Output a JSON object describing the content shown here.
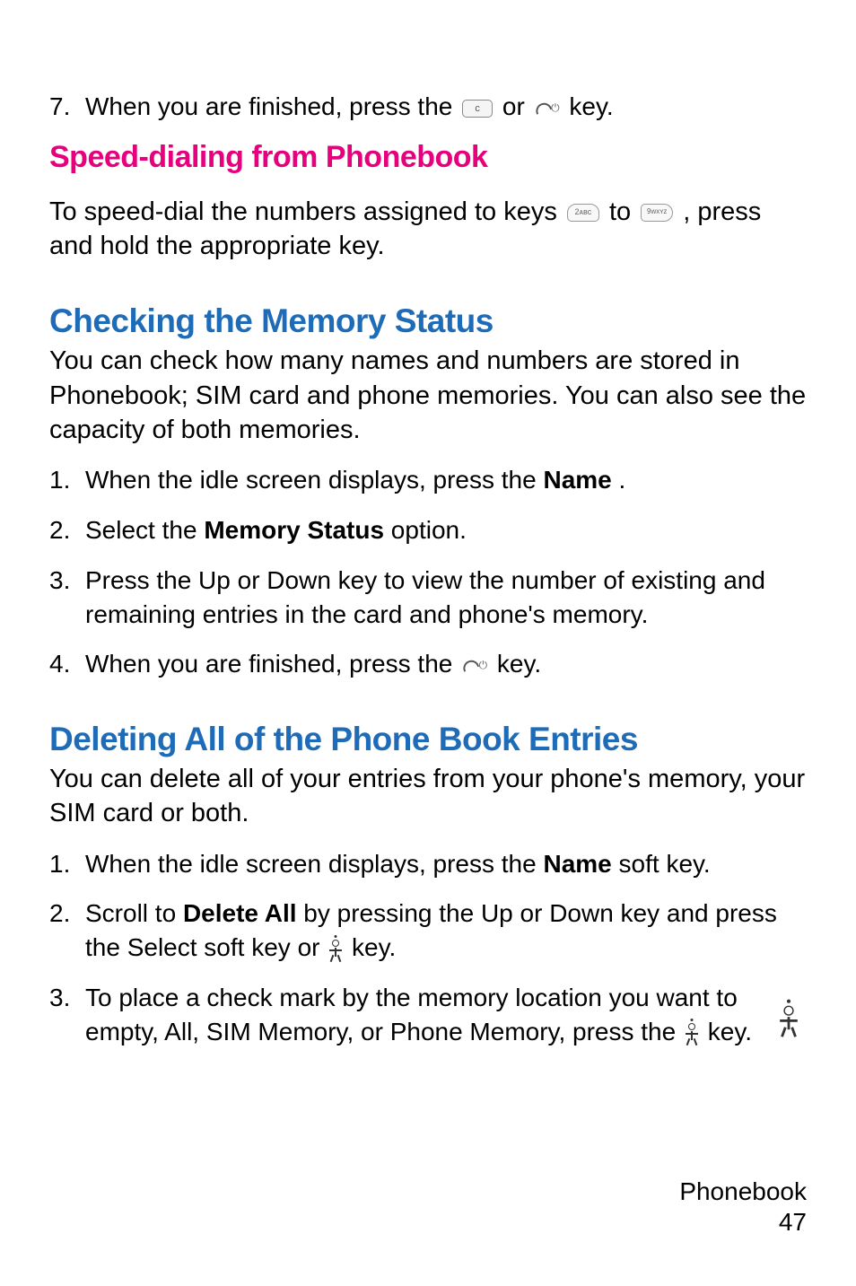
{
  "step7": {
    "num": "7.",
    "text_before": "When you are finished, press the ",
    "text_mid": " or ",
    "text_after": " key."
  },
  "speed_dial": {
    "heading": "Speed-dialing from Phonebook",
    "para_before": "To speed-dial the numbers assigned to keys ",
    "para_mid": " to ",
    "para_after": " , press and hold the appropriate key."
  },
  "memory_status": {
    "heading": "Checking the Memory Status",
    "intro": "You can check how many names and numbers are stored in Phonebook; SIM card and phone memories. You can also see the capacity of both memories.",
    "steps": [
      {
        "num": "1.",
        "pre": "When the idle screen displays, press the ",
        "bold": "Name",
        "post": "           ."
      },
      {
        "num": "2.",
        "pre": "Select the ",
        "bold": "Memory Status",
        "post": " option."
      },
      {
        "num": "3.",
        "pre": "Press the Up or Down key to view the number of existing and remaining entries in the card and phone's memory.",
        "bold": "",
        "post": ""
      },
      {
        "num": "4.",
        "pre": "When you are finished, press the ",
        "bold": "",
        "post": "  key.",
        "has_end_icon": true
      }
    ]
  },
  "delete_all": {
    "heading": "Deleting All of the Phone Book Entries",
    "intro": "You can delete all of your entries from your phone's memory, your SIM card or both.",
    "steps": [
      {
        "num": "1.",
        "pre": "When the idle screen displays, press the ",
        "bold": "Name",
        "post": " soft key."
      },
      {
        "num": "2.",
        "pre": "Scroll to ",
        "bold": "Delete All",
        "post": " by pressing the Up or Down key and press the Select soft key or ",
        "has_person_icon": true,
        "tail": " key."
      },
      {
        "num": "3.",
        "pre": "To place a check mark by the memory location you want to empty, All, SIM Memory, or Phone Memory, press the ",
        "bold": "",
        "post": "",
        "has_person_icon": true,
        "tail": " key."
      }
    ]
  },
  "footer": {
    "section": "Phonebook",
    "page": "47"
  }
}
